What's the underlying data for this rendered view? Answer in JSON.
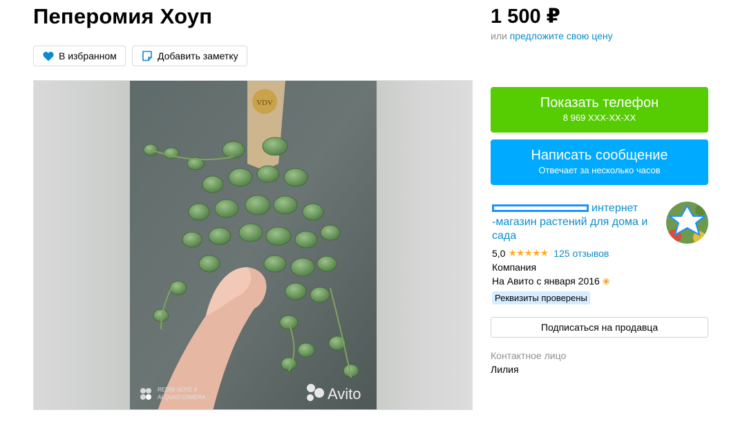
{
  "listing": {
    "title": "Пеперомия Хоуп",
    "favorite_label": "В избранном",
    "note_label": "Добавить заметку"
  },
  "price": {
    "value": "1 500 ₽",
    "prefix": "или",
    "offer_link": "предложите свою цену"
  },
  "actions": {
    "phone_label": "Показать телефон",
    "phone_number": "8 969 XXX-XX-XX",
    "message_label": "Написать сообщение",
    "message_sub": "Отвечает за несколько часов",
    "subscribe_label": "Подписаться на продавца"
  },
  "seller": {
    "name_part1": "интернет",
    "name_part2": "-магазин растений для дома и сада",
    "rating": "5,0",
    "stars": "★★★★★",
    "reviews": "125 отзывов",
    "type": "Компания",
    "since": "На Авито с января 2016",
    "verified_badge": "Реквизиты проверены"
  },
  "contact": {
    "label": "Контактное лицо",
    "name": "Лилия"
  },
  "gallery": {
    "watermark_brand": "Avito",
    "camera_line1": "REDMI NOTE 9",
    "camera_line2": "AI QUAD CAMERA",
    "tag_text": "VDV"
  },
  "colors": {
    "phone_button": "#56cc03",
    "message_button": "#00aaff",
    "link": "#0a8ccc",
    "star": "#ffb021"
  }
}
